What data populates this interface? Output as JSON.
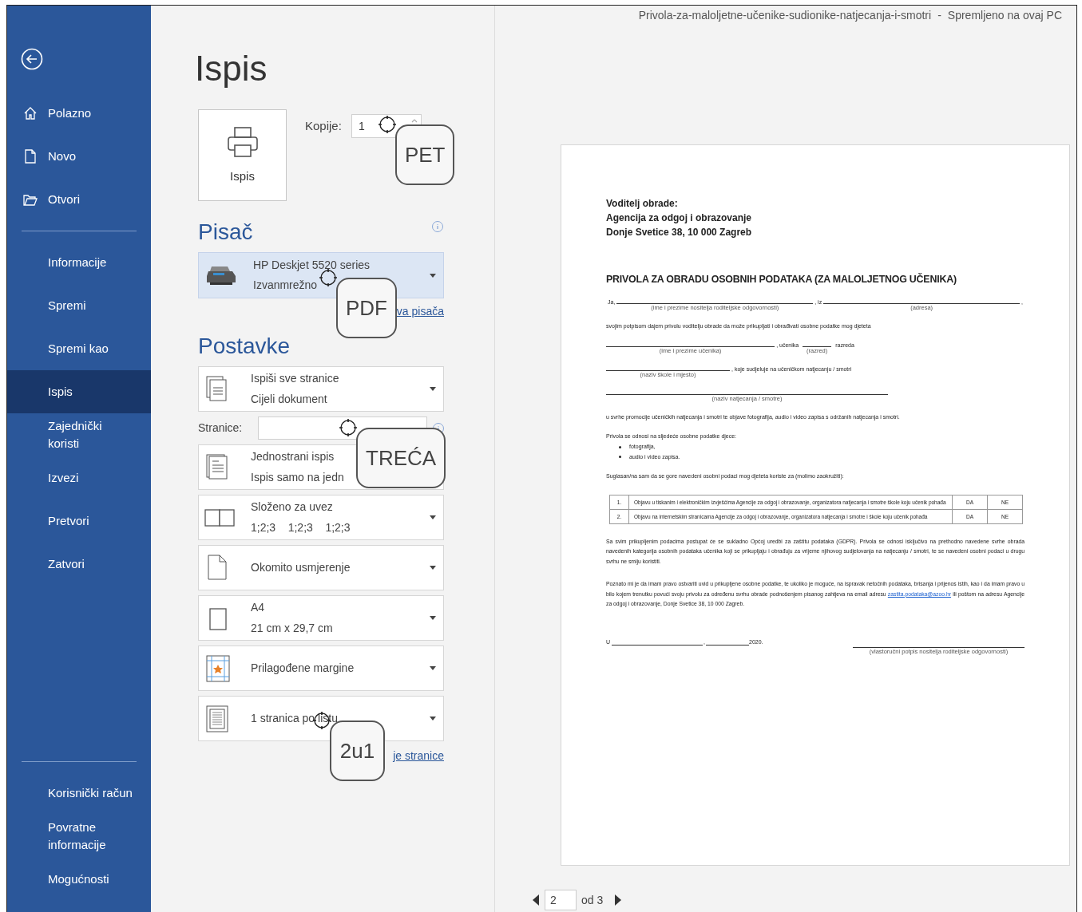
{
  "title_bar": {
    "document": "Privola-za-maloljetne-učenike-sudionike-natjecanja-i-smotri",
    "separator": "-",
    "status": "Spremljeno na ovaj PC"
  },
  "sidebar": {
    "groups": [
      [
        {
          "label": "Polazno",
          "kind": "home",
          "selected": false
        },
        {
          "label": "Novo",
          "kind": "new",
          "selected": false
        },
        {
          "label": "Otvori",
          "kind": "open",
          "selected": false
        }
      ],
      [
        {
          "label": "Informacije",
          "selected": false
        },
        {
          "label": "Spremi",
          "selected": false
        },
        {
          "label": "Spremi kao",
          "selected": false
        },
        {
          "label": "Ispis",
          "selected": true
        },
        {
          "label": "Zajednički koristi",
          "selected": false
        },
        {
          "label": "Izvezi",
          "selected": false
        },
        {
          "label": "Pretvori",
          "selected": false
        },
        {
          "label": "Zatvori",
          "selected": false
        }
      ],
      [
        {
          "label": "Korisnički račun",
          "selected": false
        },
        {
          "label": "Povratne informacije",
          "selected": false
        },
        {
          "label": "Mogućnosti",
          "selected": false
        }
      ]
    ]
  },
  "print": {
    "heading": "Ispis",
    "button": "Ispis",
    "copies": {
      "label": "Kopije:",
      "value": "1",
      "callout": "PET"
    },
    "printer_heading": "Pisač",
    "printer": {
      "name": "HP Deskjet 5520 series",
      "status": "Izvanmrežno",
      "callout": "PDF"
    },
    "printer_link": "va pisača",
    "settings_heading": "Postavke",
    "settings": [
      {
        "kind": "pages",
        "title": "Ispiši sve stranice",
        "subtitle": "Cijeli dokument"
      },
      {
        "kind": "pages_field",
        "label": "Stranice:",
        "callout": "TREĆA"
      },
      {
        "kind": "one_sided",
        "title": "Jednostrani ispis",
        "subtitle": "Ispis samo na jedn"
      },
      {
        "kind": "collated",
        "title": "Složeno za uvez",
        "subtitle": "1;2;3    1;2;3    1;2;3"
      },
      {
        "kind": "portrait",
        "title": "Okomito usmjerenje"
      },
      {
        "kind": "paper",
        "title": "A4",
        "subtitle": "21 cm x 29,7 cm"
      },
      {
        "kind": "margins",
        "title": "Prilagođene margine"
      },
      {
        "kind": "per_sheet",
        "title": "1 stranica po listu",
        "callout": "2u1"
      }
    ],
    "page_setup_link": "je stranice"
  },
  "preview": {
    "document": [
      {
        "kind": "header",
        "lines": [
          "Voditelj obrade:",
          "Agencija za odgoj i obrazovanje",
          "Donje Svetice 38, 10 000 Zagreb"
        ]
      },
      {
        "kind": "title",
        "text": "PRIVOLA ZA OBRADU OSOBNIH PODATAKA (ZA MALOLJETNOG UČENIKA)"
      },
      {
        "kind": "fill",
        "segments": [
          {
            "kind": "text",
            "text": "Ja,"
          },
          {
            "kind": "blank",
            "caption": "(ime i prezime nositelja roditeljske odgovornosti)"
          },
          {
            "kind": "text",
            "text": ", iz"
          },
          {
            "kind": "blank",
            "caption": "(adresa)"
          },
          {
            "kind": "text",
            "text": ","
          }
        ]
      },
      {
        "kind": "text",
        "text": "svojim potpisom dajem privolu voditelju obrade da može prikupljati i obrađivati osobne podatke mog djeteta"
      },
      {
        "kind": "fill",
        "segments": [
          {
            "kind": "blank",
            "caption": "(ime i prezime učenika)"
          },
          {
            "kind": "text",
            "text": ", učenika"
          },
          {
            "kind": "short_blank",
            "caption": "(razred)"
          },
          {
            "kind": "text",
            "text": "razreda"
          },
          {
            "kind": "gap"
          }
        ]
      },
      {
        "kind": "fill",
        "segments": [
          {
            "kind": "medium_blank",
            "caption": "(naziv škole i mjesto)"
          },
          {
            "kind": "text",
            "text": ", koje sudjeluje na učeničkom natjecanju / smotri"
          },
          {
            "kind": "gap"
          }
        ]
      },
      {
        "kind": "fill",
        "segments": [
          {
            "kind": "wide_blank",
            "caption": "(naziv natjecanja / smotre)"
          },
          {
            "kind": "gap"
          }
        ]
      },
      {
        "kind": "text",
        "text": "u svrhe promocije učeničkih natjecanja i smotri te objave fotografija, audio i video zapisa s održanih natjecanja i smotri."
      },
      {
        "kind": "text",
        "text": "Privola se odnosi na sljedeće osobne podatke djece:"
      },
      {
        "kind": "bullets",
        "items": [
          "fotografija,",
          "audio i video zapisa."
        ]
      },
      {
        "kind": "text",
        "text": "Suglasan/na sam da se gore navedeni osobni podaci mog djeteta koriste za (molimo zaokružiti):"
      },
      {
        "kind": "table",
        "rows": [
          [
            "1.",
            "Objavu u tiskanim i elektroničkim izvješćima Agencije za odgoj i obrazovanje, organizatora natjecanja i smotre škole koju učenik pohađa",
            "DA",
            "NE"
          ],
          [
            "2.",
            "Objavu na internetskim stranicama Agencije za odgoj i obrazovanje, organizatora natjecanja i smotre i škole koju učenik pohađa",
            "DA",
            "NE"
          ]
        ]
      },
      {
        "kind": "paragraph",
        "text": "Sa svim prikupljenim podacima postupat će se sukladno Općoj uredbi za zaštitu podataka (GDPR). Privola se odnosi isključivo na prethodno navedene svrhe obrada navedenih kategorija osobnih podataka učenika koji se prikupljaju i obrađuju za vrijeme njihovog sudjelovanja na natjecanju / smotri, te se navedeni osobni podaci u drugu svrhu ne smiju koristiti."
      },
      {
        "kind": "paragraph",
        "text": "Poznato mi je da imam pravo ostvariti uvid u prikupljene osobne podatke, te ukoliko je moguće, na ispravak netočnih podataka, brisanja i prijenos istih, kao i da imam pravo u bilo kojem trenutku povući svoju privolu za određenu svrhu obrade podnošenjem pisanog zahtjeva na email adresu",
        "link": "zastita.podataka@azoo.hr",
        "after": "ili poštom na adresu Agencije za odgoj i obrazovanje, Donje Svetice 38, 10 000 Zagreb."
      },
      {
        "kind": "signature",
        "place": "U",
        "comma": ",",
        "year": "2020.",
        "caption": "(vlastoručni potpis nositelja roditeljske odgovornosti)"
      }
    ],
    "page": "2",
    "of": "od 3"
  }
}
